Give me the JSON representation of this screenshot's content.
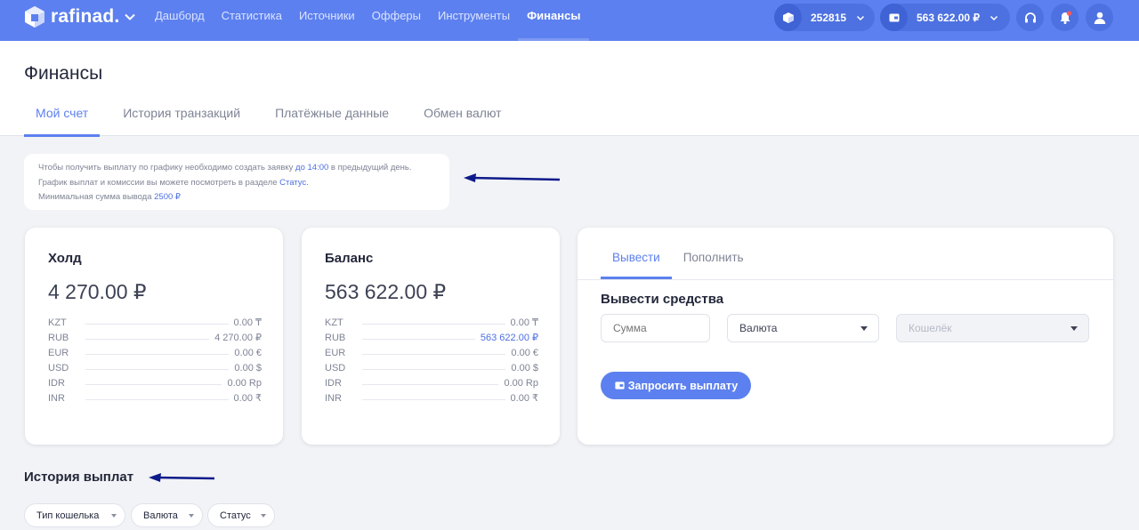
{
  "brand": {
    "name": "rafinad."
  },
  "nav": {
    "items": [
      {
        "label": "Дашборд"
      },
      {
        "label": "Статистика"
      },
      {
        "label": "Источники"
      },
      {
        "label": "Офферы"
      },
      {
        "label": "Инструменты"
      },
      {
        "label": "Финансы",
        "active": true
      }
    ]
  },
  "header": {
    "account_id": "252815",
    "balance": "563 622.00 ₽"
  },
  "page": {
    "title": "Финансы",
    "tabs": [
      {
        "label": "Мой счет",
        "active": true
      },
      {
        "label": "История транзакций"
      },
      {
        "label": "Платёжные данные"
      },
      {
        "label": "Обмен валют"
      }
    ]
  },
  "notice": {
    "line1_prefix": "Чтобы получить выплату по графику необходимо создать заявку ",
    "line1_time": "до 14:00",
    "line1_suffix": " в предыдущий день.",
    "line2_prefix": "График выплат и комиссии вы можете посмотреть в разделе ",
    "line2_link": "Статус.",
    "line3_prefix": "Минимальная сумма вывода ",
    "line3_amount": "2500 ₽"
  },
  "hold": {
    "title": "Холд",
    "total": "4 270.00 ₽",
    "rows": [
      {
        "cur": "KZT",
        "val": "0.00 ₸"
      },
      {
        "cur": "RUB",
        "val": "4 270.00 ₽"
      },
      {
        "cur": "EUR",
        "val": "0.00 €"
      },
      {
        "cur": "USD",
        "val": "0.00 $"
      },
      {
        "cur": "IDR",
        "val": "0.00 Rp"
      },
      {
        "cur": "INR",
        "val": "0.00 ₹"
      }
    ]
  },
  "balance": {
    "title": "Баланс",
    "total": "563 622.00 ₽",
    "rows": [
      {
        "cur": "KZT",
        "val": "0.00 ₸"
      },
      {
        "cur": "RUB",
        "val": "563 622.00 ₽"
      },
      {
        "cur": "EUR",
        "val": "0.00 €"
      },
      {
        "cur": "USD",
        "val": "0.00 $"
      },
      {
        "cur": "IDR",
        "val": "0.00 Rp"
      },
      {
        "cur": "INR",
        "val": "0.00 ₹"
      }
    ]
  },
  "withdraw": {
    "tabs": [
      {
        "label": "Вывести",
        "active": true
      },
      {
        "label": "Пополнить"
      }
    ],
    "title": "Вывести средства",
    "amount_placeholder": "Сумма",
    "currency_label": "Валюта",
    "wallet_label": "Кошелёк",
    "submit_label": "Запросить выплату"
  },
  "history": {
    "title": "История выплат",
    "filters": [
      {
        "label": "Тип кошелька"
      },
      {
        "label": "Валюта"
      },
      {
        "label": "Статус"
      }
    ]
  },
  "colors": {
    "accent": "#5c80ef",
    "nav_bg": "#5c80ef",
    "arrow": "#0d1a8a"
  }
}
